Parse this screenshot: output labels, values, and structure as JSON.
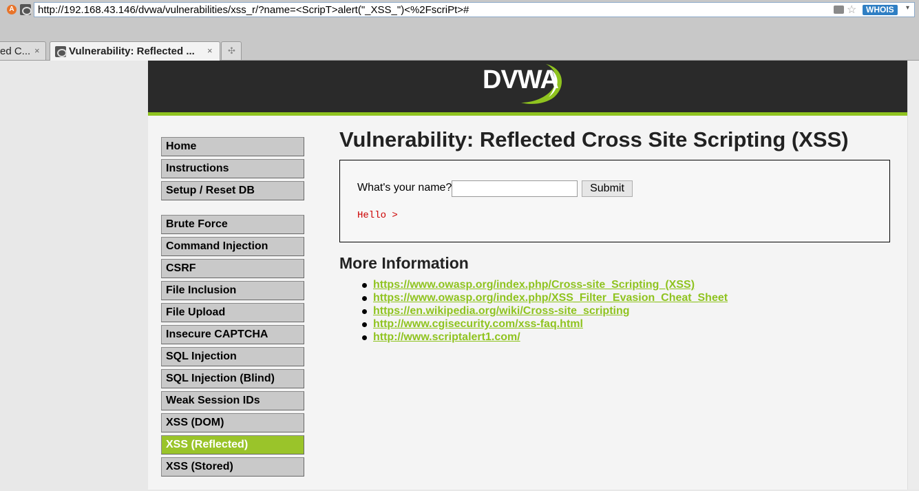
{
  "browser": {
    "url": "http://192.168.43.146/dvwa/vulnerabilities/xss_r/?name=<ScripT>alert(\"_XSS_\")<%2FscriPt>#",
    "whois_label": "WHOIS",
    "tabs": [
      {
        "label": "ed C...",
        "close": "×"
      },
      {
        "label": "Vulnerability: Reflected ...",
        "close": "×"
      },
      {
        "label": "✣"
      }
    ]
  },
  "header": {
    "logo_text": "DVWA",
    "accent_color": "#8fc31f"
  },
  "menu": {
    "top": [
      "Home",
      "Instructions",
      "Setup / Reset DB"
    ],
    "vulns": [
      "Brute Force",
      "Command Injection",
      "CSRF",
      "File Inclusion",
      "File Upload",
      "Insecure CAPTCHA",
      "SQL Injection",
      "SQL Injection (Blind)",
      "Weak Session IDs",
      "XSS (DOM)",
      "XSS (Reflected)",
      "XSS (Stored)"
    ],
    "active": "XSS (Reflected)"
  },
  "main": {
    "title": "Vulnerability: Reflected Cross Site Scripting (XSS)",
    "form": {
      "label": "What's your name?",
      "input_value": "",
      "submit_label": "Submit"
    },
    "output": "Hello >",
    "more_info_title": "More Information",
    "links": [
      "https://www.owasp.org/index.php/Cross-site_Scripting_(XSS)",
      "https://www.owasp.org/index.php/XSS_Filter_Evasion_Cheat_Sheet",
      "https://en.wikipedia.org/wiki/Cross-site_scripting",
      "http://www.cgisecurity.com/xss-faq.html",
      "http://www.scriptalert1.com/"
    ]
  }
}
